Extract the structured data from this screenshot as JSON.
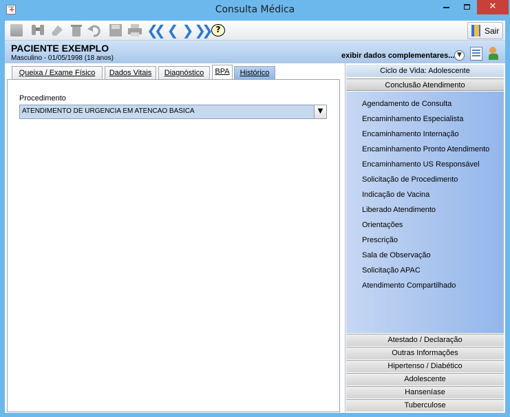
{
  "window": {
    "title": "Consulta Médica"
  },
  "toolbar": {
    "help_glyph": "?",
    "exit_label": "Sair"
  },
  "patient": {
    "name": "PACIENTE EXEMPLO",
    "info": "Masculino - 01/05/1998 (18 anos)",
    "more_label": "exibir dados complementares..."
  },
  "tabs": [
    {
      "label": "Queixa / Exame Físico"
    },
    {
      "label": "Dados Vitais"
    },
    {
      "label": "Diagnóstico"
    },
    {
      "label": "BPA"
    },
    {
      "label": "Histórico"
    }
  ],
  "procedure": {
    "label": "Procedimento",
    "value": "ATENDIMENTO DE URGENCIA EM ATENCAO BASICA"
  },
  "side": {
    "life_cycle": "Ciclo de Vida: Adolescente",
    "conclusion": "Conclusão Atendimento",
    "links": [
      "Agendamento de Consulta",
      "Encaminhamento Especialista",
      "Encaminhamento Internação",
      "Encaminhamento Pronto Atendimento",
      "Encaminhamento US Responsável",
      "Solicitação de Procedimento",
      "Indicação de Vacina",
      "Liberado Atendimento",
      "Orientações",
      "Prescrição",
      "Sala de Observação",
      "Solicitação APAC",
      "Atendimento Compartilhado"
    ],
    "sections": [
      "Atestado / Declaração",
      "Outras Informações",
      "Hipertenso / Diabético",
      "Adolescente",
      "Hanseníase",
      "Tuberculose"
    ]
  }
}
